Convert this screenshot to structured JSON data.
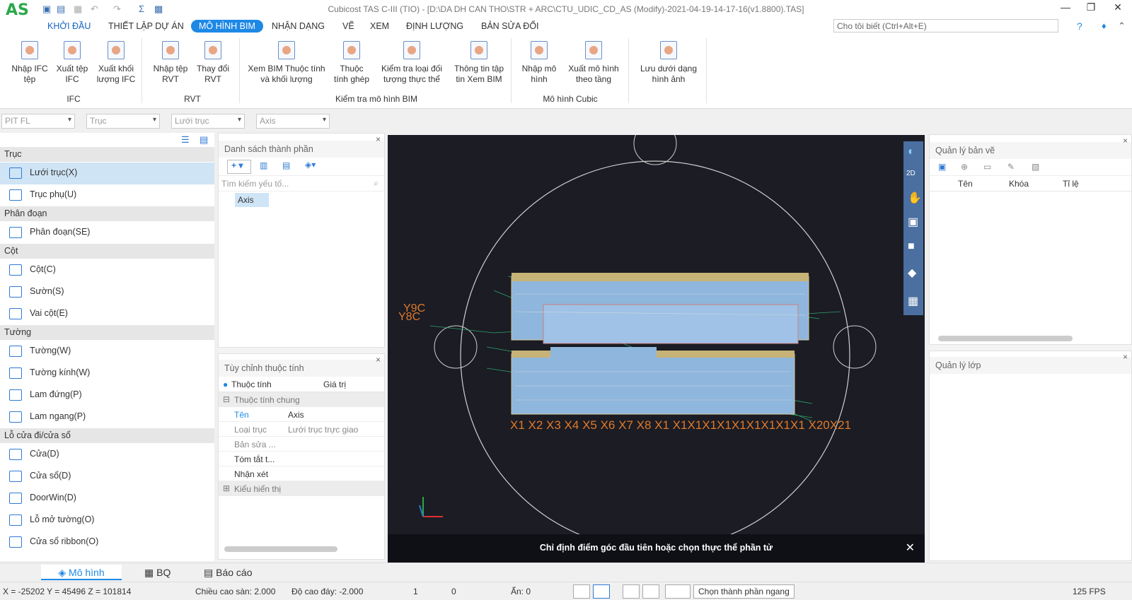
{
  "app": {
    "title": "Cubicost TAS C-III (TIO) - [D:\\DA DH CAN THO\\STR + ARC\\CTU_UDIC_CD_AS (Modify)-2021-04-19-14-17-16(v1.8800).TAS]",
    "logo": "AS"
  },
  "menu": {
    "items": [
      "KHỞI ĐẦU",
      "THIẾT LẬP DỰ ÁN",
      "MÔ HÌNH BIM",
      "NHẬN DẠNG",
      "VẼ",
      "XEM",
      "ĐỊNH LƯỢNG",
      "BẢN SỬA ĐỔI"
    ],
    "active": "MÔ HÌNH BIM",
    "tell_me": "Cho tôi biết (Ctrl+Alt+E)"
  },
  "ribbon": {
    "buttons": [
      "Nhập IFC\ntệp",
      "Xuất tệp\nIFC",
      "Xuất khối\nlượng IFC",
      "Nhập tệp\nRVT",
      "Thay đổi\nRVT",
      "Xem BIM Thuộc tính\nvà khối lượng",
      "Thuộc\ntính ghép",
      "Kiểm tra loại đối\ntượng thực thể",
      "Thông tin tập\ntin Xem BIM",
      "Nhập mô\nhình",
      "Xuất mô hình\ntheo tầng",
      "Lưu dưới dạng\nhình ảnh"
    ],
    "groups": [
      "IFC",
      "RVT",
      "Kiểm tra mô hình BIM",
      "Mô hình Cubic"
    ]
  },
  "filters": [
    "PIT FL",
    "Trục",
    "Lưới trục",
    "Axis"
  ],
  "left": {
    "categories": [
      "Trục",
      "Phân đoạn",
      "Cột",
      "Tường",
      "Lỗ cửa đi/cửa sổ"
    ],
    "items": [
      "Lưới trục(X)",
      "Trục phụ(U)",
      "Phân đoạn(SE)",
      "Cột(C)",
      "Sườn(S)",
      "Vai cột(E)",
      "Tường(W)",
      "Tường kính(W)",
      "Lam đứng(P)",
      "Lam ngang(P)",
      "Cửa(D)",
      "Cửa sổ(D)",
      "DoorWin(D)",
      "Lỗ mở tường(O)",
      "Cửa sổ ribbon(O)"
    ]
  },
  "component_list": {
    "title": "Danh sách thành phần",
    "search_placeholder": "Tìm kiếm yếu tố...",
    "selected": "Axis"
  },
  "properties": {
    "title": "Tùy chỉnh thuộc tính",
    "col_name": "Thuộc tính",
    "col_value": "Giá trị",
    "group1": "Thuộc tính chung",
    "group2": "Kiểu hiển thị",
    "rows": [
      {
        "name": "Tên",
        "value": "Axis"
      },
      {
        "name": "Loại trục",
        "value": "Lưới trục trực giao"
      },
      {
        "name": "Bản sửa ...",
        "value": ""
      },
      {
        "name": "Tóm tắt t...",
        "value": ""
      },
      {
        "name": "Nhận xét",
        "value": ""
      }
    ]
  },
  "viewport": {
    "status": "Chỉ định điểm góc đầu tiên hoặc chọn thực thể phần tử",
    "axes_x": "X1 X2 X3 X4 X5 X6 X7 X8 X1 X1X1X1X1X1X1X1X1X1 X20X21",
    "axes_y": [
      "Y9C",
      "Y8C"
    ]
  },
  "drawing_manager": {
    "title": "Quản lý bản vẽ",
    "cols": [
      "Tên",
      "Khóa",
      "Tỉ lệ"
    ]
  },
  "layer_manager": {
    "title": "Quản lý lớp"
  },
  "tabs": [
    "Mô hình",
    "BQ",
    "Báo cáo"
  ],
  "status": {
    "coords": "X = -25202 Y = 45496 Z = 101814",
    "floor_height": "Chiều cao sàn: 2.000",
    "bottom_height": "Độ cao đáy: -2.000",
    "val1": "1",
    "val2": "0",
    "hidden": "Ẩn: 0",
    "select_mode": "Chọn thành phần ngang",
    "fps": "125 FPS"
  },
  "colors": {
    "accent": "#1e88e5",
    "viewport_bg": "#1b1c24",
    "grid": "#2fa36b",
    "axis_label": "#e07a2a"
  }
}
